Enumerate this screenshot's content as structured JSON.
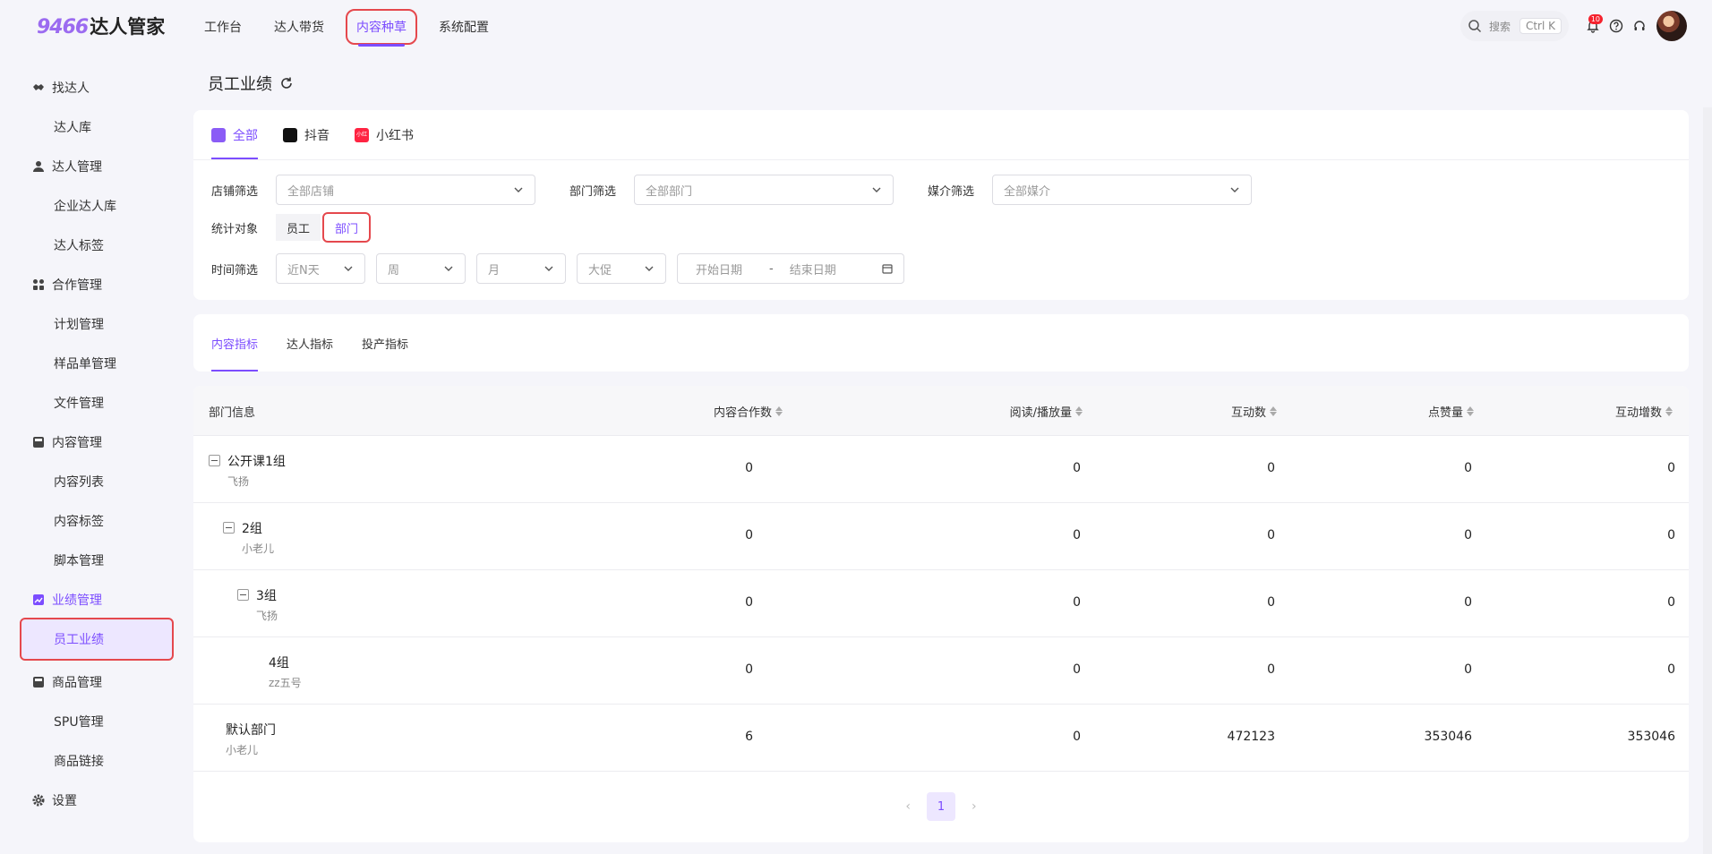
{
  "logo": {
    "num": "9466",
    "text": "达人管家"
  },
  "topnav": [
    "工作台",
    "达人带货",
    "内容种草",
    "系统配置"
  ],
  "search": {
    "label": "搜索",
    "kbd": "Ctrl K"
  },
  "notify_count": "10",
  "sidebar": {
    "items": [
      {
        "label": "找达人",
        "type": "group"
      },
      {
        "label": "达人库",
        "type": "sub"
      },
      {
        "label": "达人管理",
        "type": "group"
      },
      {
        "label": "企业达人库",
        "type": "sub"
      },
      {
        "label": "达人标签",
        "type": "sub"
      },
      {
        "label": "合作管理",
        "type": "group"
      },
      {
        "label": "计划管理",
        "type": "sub"
      },
      {
        "label": "样品单管理",
        "type": "sub"
      },
      {
        "label": "文件管理",
        "type": "sub"
      },
      {
        "label": "内容管理",
        "type": "group"
      },
      {
        "label": "内容列表",
        "type": "sub"
      },
      {
        "label": "内容标签",
        "type": "sub"
      },
      {
        "label": "脚本管理",
        "type": "sub"
      },
      {
        "label": "业绩管理",
        "type": "group"
      },
      {
        "label": "员工业绩",
        "type": "sub"
      },
      {
        "label": "商品管理",
        "type": "group"
      },
      {
        "label": "SPU管理",
        "type": "sub"
      },
      {
        "label": "商品链接",
        "type": "sub"
      },
      {
        "label": "设置",
        "type": "group"
      }
    ]
  },
  "page_title": "员工业绩",
  "media_tabs": [
    "全部",
    "抖音",
    "小红书"
  ],
  "xhs_icon_text": "小红书",
  "filters": {
    "shop_label": "店铺筛选",
    "shop_placeholder": "全部店铺",
    "dept_label": "部门筛选",
    "dept_placeholder": "全部部门",
    "media_label": "媒介筛选",
    "media_placeholder": "全部媒介",
    "target_label": "统计对象",
    "target_options": [
      "员工",
      "部门"
    ],
    "time_label": "时间筛选",
    "time_selects": [
      "近N天",
      "周",
      "月",
      "大促"
    ],
    "start_date": "开始日期",
    "date_sep": "-",
    "end_date": "结束日期"
  },
  "metric_tabs": [
    "内容指标",
    "达人指标",
    "投产指标"
  ],
  "table": {
    "headers": [
      "部门信息",
      "内容合作数",
      "阅读/播放量",
      "互动数",
      "点赞量",
      "互动增数"
    ],
    "rows": [
      {
        "name": "公开课1组",
        "leader": "飞扬",
        "values": [
          "0",
          "0",
          "0",
          "0",
          "0"
        ]
      },
      {
        "name": "2组",
        "leader": "小老儿",
        "values": [
          "0",
          "0",
          "0",
          "0",
          "0"
        ]
      },
      {
        "name": "3组",
        "leader": "飞扬",
        "values": [
          "0",
          "0",
          "0",
          "0",
          "0"
        ]
      },
      {
        "name": "4组",
        "leader": "zz五号",
        "values": [
          "0",
          "0",
          "0",
          "0",
          "0"
        ]
      },
      {
        "name": "默认部门",
        "leader": "小老儿",
        "values": [
          "6",
          "0",
          "472123",
          "353046",
          "353046"
        ]
      }
    ]
  },
  "pager": {
    "current": "1",
    "prev": "‹",
    "next": "›"
  },
  "colors": {
    "accent": "#7c4dff",
    "highlight": "#e5484d"
  }
}
